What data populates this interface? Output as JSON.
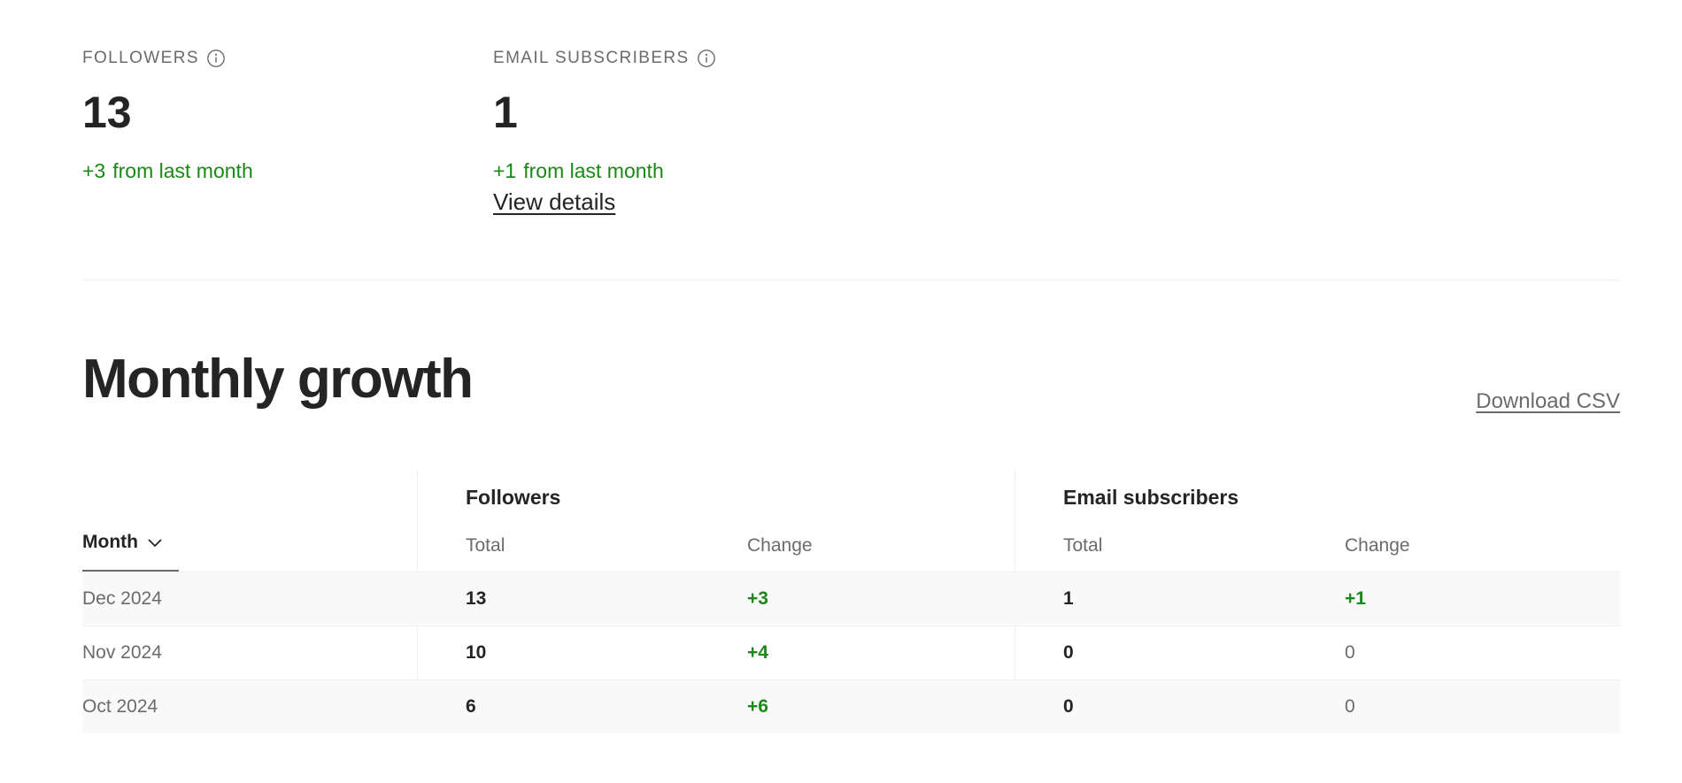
{
  "stats": {
    "followers": {
      "label": "FOLLOWERS",
      "value": "13",
      "delta": "+3",
      "suffix": "from last month"
    },
    "email": {
      "label": "EMAIL SUBSCRIBERS",
      "value": "1",
      "delta": "+1",
      "suffix": "from last month",
      "link": "View details"
    }
  },
  "section": {
    "title": "Monthly growth",
    "download": "Download CSV"
  },
  "table": {
    "month_header": "Month",
    "groups": [
      "Followers",
      "Email subscribers"
    ],
    "subheaders": [
      "Total",
      "Change",
      "Total",
      "Change"
    ],
    "rows": [
      {
        "month": "Dec 2024",
        "followers_total": "13",
        "followers_change": "+3",
        "email_total": "1",
        "email_change": "+1"
      },
      {
        "month": "Nov 2024",
        "followers_total": "10",
        "followers_change": "+4",
        "email_total": "0",
        "email_change": "0"
      },
      {
        "month": "Oct 2024",
        "followers_total": "6",
        "followers_change": "+6",
        "email_total": "0",
        "email_change": "0"
      }
    ]
  },
  "colors": {
    "positive": "#1a8917",
    "text": "#242424",
    "muted": "#6b6b6b",
    "row_shade": "#f9f9f9"
  }
}
